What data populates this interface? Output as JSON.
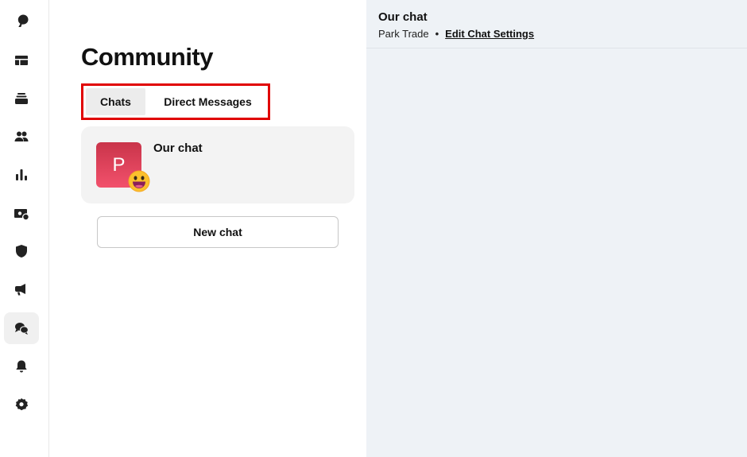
{
  "sidebar": {
    "items": [
      {
        "icon": "patreon-logo-icon",
        "active": false
      },
      {
        "icon": "library-icon",
        "active": false
      },
      {
        "icon": "collections-icon",
        "active": false
      },
      {
        "icon": "audience-icon",
        "active": false
      },
      {
        "icon": "insights-icon",
        "active": false
      },
      {
        "icon": "payouts-icon",
        "active": false
      },
      {
        "icon": "shield-icon",
        "active": false
      },
      {
        "icon": "megaphone-icon",
        "active": false
      },
      {
        "icon": "chat-bubbles-icon",
        "active": true
      },
      {
        "icon": "bell-icon",
        "active": false
      },
      {
        "icon": "settings-icon",
        "active": false
      }
    ]
  },
  "main": {
    "title": "Community",
    "tabs": [
      {
        "label": "Chats",
        "selected": true
      },
      {
        "label": "Direct Messages",
        "selected": false
      }
    ],
    "chat_list": [
      {
        "avatar_letter": "P",
        "name": "Our chat",
        "emoji_icon": "grinning-face-icon"
      }
    ],
    "new_chat_label": "New chat"
  },
  "chat_panel": {
    "title": "Our chat",
    "creator": "Park Trade",
    "separator": "•",
    "edit_link": "Edit Chat Settings"
  },
  "colors": {
    "highlight_border": "#e00000",
    "avatar": "#e0455e",
    "right_panel_bg": "#eef2f6"
  }
}
